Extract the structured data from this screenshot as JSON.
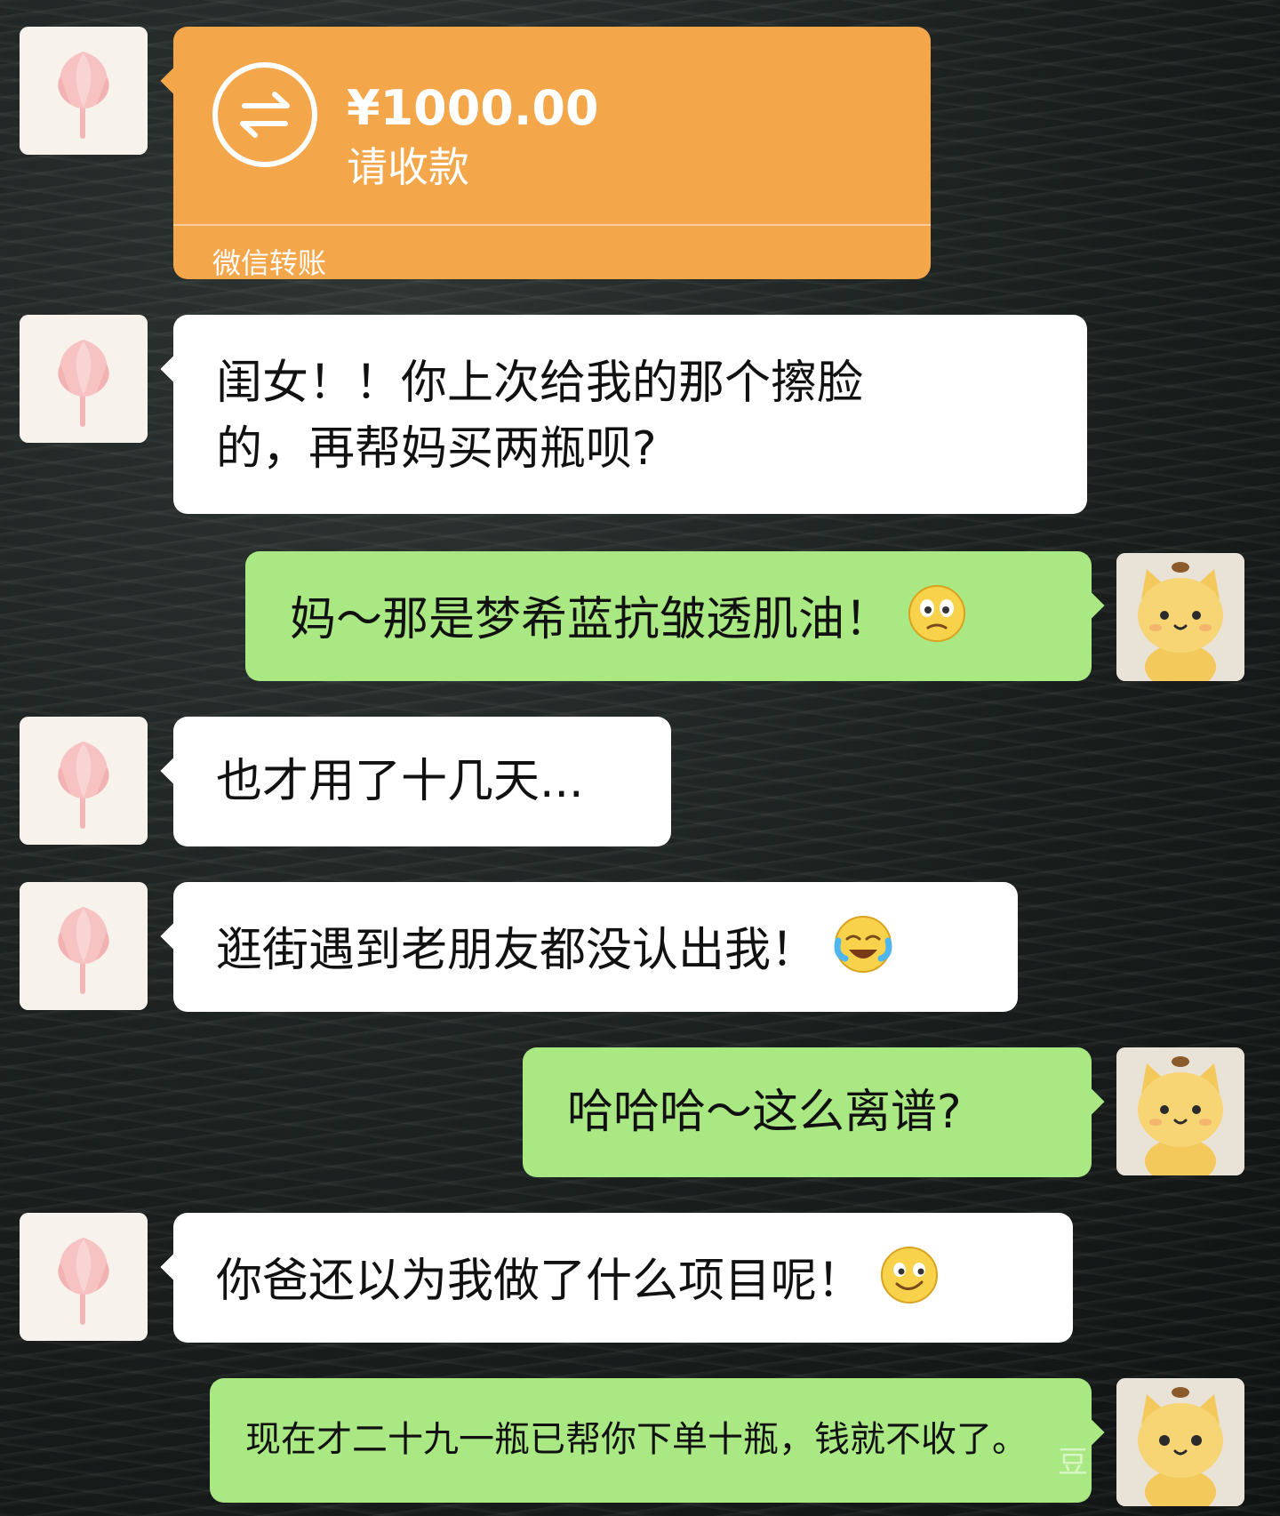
{
  "transfer": {
    "amount": "¥1000.00",
    "status": "请收款",
    "footer": "微信转账",
    "icon": "transfer-arrows-icon",
    "color": "#f4a64b"
  },
  "messages": [
    {
      "side": "left",
      "text_lines": [
        "闺女！！你上次给我的那个擦脸",
        "的，再帮妈买两瓶呗?"
      ]
    },
    {
      "side": "right",
      "text": "妈～那是梦希蓝抗皱透肌油！",
      "emoji": "confused-face-emoji"
    },
    {
      "side": "left",
      "text": "也才用了十几天..."
    },
    {
      "side": "left",
      "text": "逛街遇到老朋友都没认出我！",
      "emoji": "crying-laughing-emoji"
    },
    {
      "side": "right",
      "text": "哈哈哈～这么离谱?"
    },
    {
      "side": "left",
      "text": "你爸还以为我做了什么项目呢！",
      "emoji": "smirking-face-emoji"
    },
    {
      "side": "right",
      "text": "现在才二十九一瓶已帮你下单十瓶，钱就不收了。"
    }
  ],
  "avatars": {
    "left": "tulip-avatar",
    "right": "cat-avatar"
  },
  "colors": {
    "incoming_bubble": "#ffffff",
    "outgoing_bubble": "#a9e882"
  },
  "watermark": "豆"
}
